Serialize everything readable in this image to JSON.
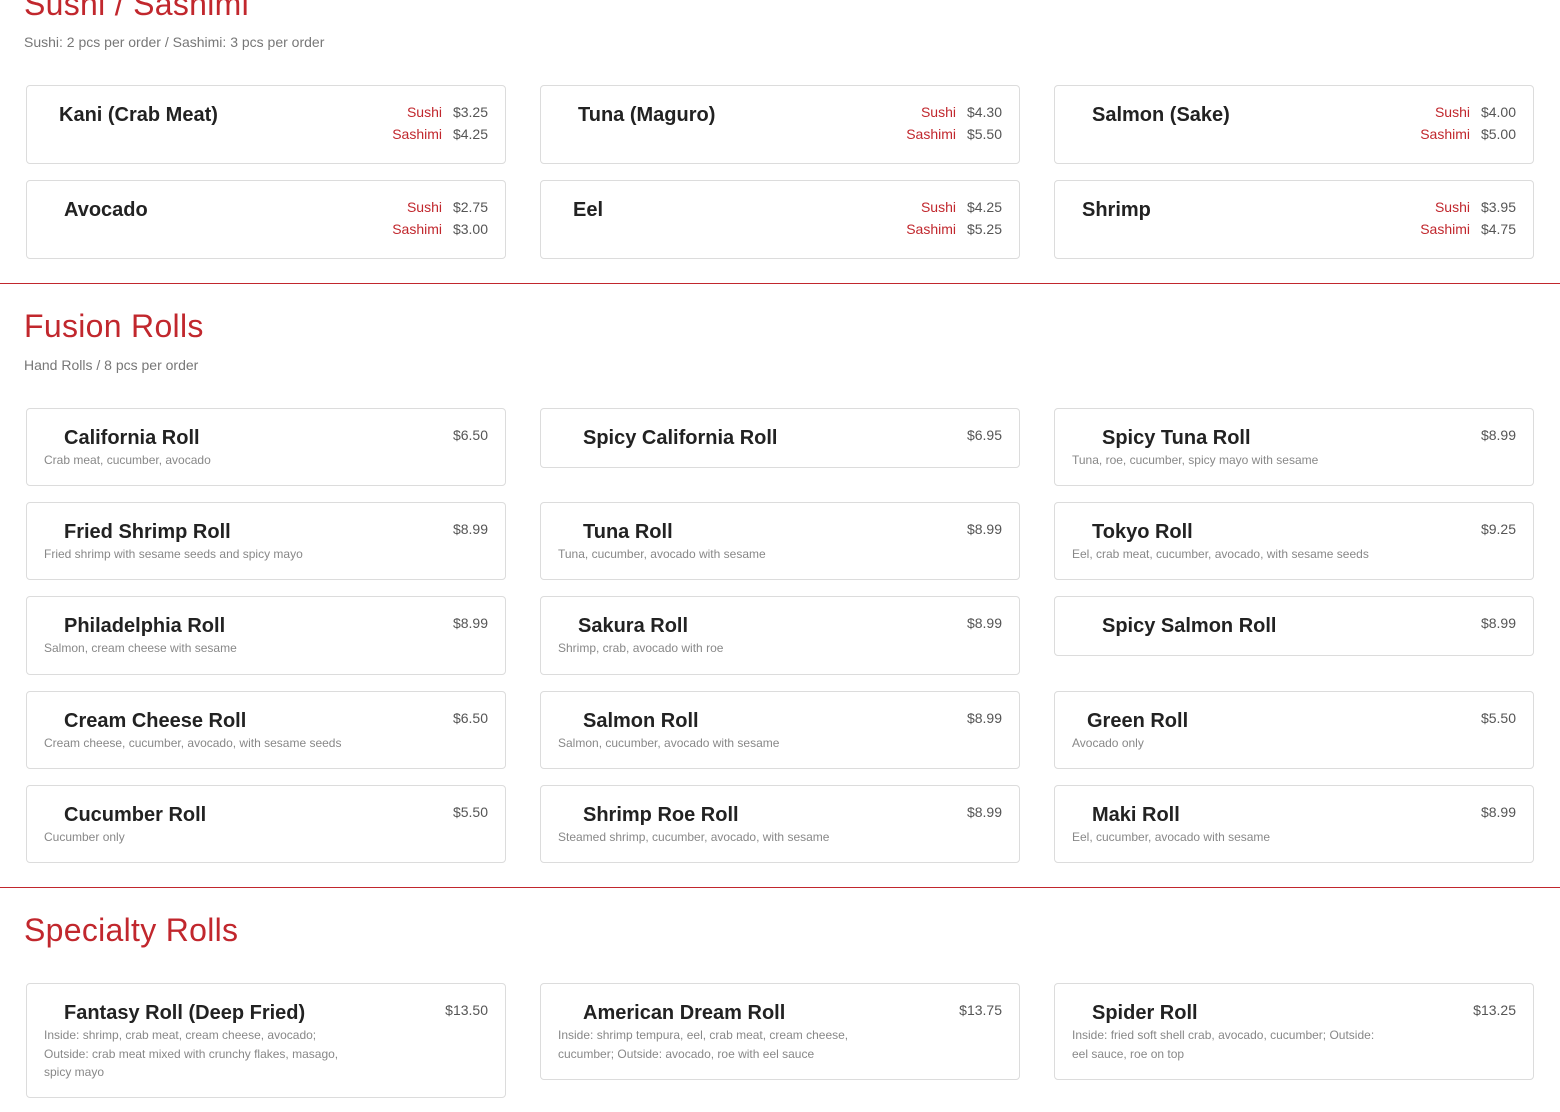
{
  "sections": {
    "sushi": {
      "title": "Sushi / Sashimi",
      "subtitle": "Sushi: 2 pcs per order / Sashimi: 3 pcs per order",
      "sushi_label": "Sushi",
      "sashimi_label": "Sashimi",
      "items": [
        {
          "name": "Kani (Crab Meat)",
          "sushi": "$3.25",
          "sashimi": "$4.25"
        },
        {
          "name": "Tuna (Maguro)",
          "sushi": "$4.30",
          "sashimi": "$5.50"
        },
        {
          "name": "Salmon (Sake)",
          "sushi": "$4.00",
          "sashimi": "$5.00"
        },
        {
          "name": "Avocado",
          "sushi": "$2.75",
          "sashimi": "$3.00"
        },
        {
          "name": "Eel",
          "sushi": "$4.25",
          "sashimi": "$5.25"
        },
        {
          "name": "Shrimp",
          "sushi": "$3.95",
          "sashimi": "$4.75"
        }
      ]
    },
    "fusion": {
      "title": "Fusion Rolls",
      "subtitle": "Hand Rolls / 8 pcs per order",
      "items": [
        {
          "name": "California Roll",
          "price": "$6.50",
          "desc": "Crab meat, cucumber, avocado"
        },
        {
          "name": "Spicy California Roll",
          "price": "$6.95",
          "desc": ""
        },
        {
          "name": "Spicy Tuna Roll",
          "price": "$8.99",
          "desc": "Tuna, roe, cucumber, spicy mayo with sesame"
        },
        {
          "name": "Fried Shrimp Roll",
          "price": "$8.99",
          "desc": "Fried shrimp with sesame seeds and spicy mayo"
        },
        {
          "name": "Tuna Roll",
          "price": "$8.99",
          "desc": "Tuna, cucumber, avocado with sesame"
        },
        {
          "name": "Tokyo Roll",
          "price": "$9.25",
          "desc": "Eel, crab meat, cucumber, avocado, with sesame seeds"
        },
        {
          "name": "Philadelphia Roll",
          "price": "$8.99",
          "desc": "Salmon, cream cheese with sesame"
        },
        {
          "name": "Sakura Roll",
          "price": "$8.99",
          "desc": "Shrimp, crab, avocado with roe"
        },
        {
          "name": "Spicy Salmon Roll",
          "price": "$8.99",
          "desc": ""
        },
        {
          "name": "Cream Cheese Roll",
          "price": "$6.50",
          "desc": "Cream cheese, cucumber, avocado, with sesame seeds"
        },
        {
          "name": "Salmon Roll",
          "price": "$8.99",
          "desc": "Salmon, cucumber, avocado with sesame"
        },
        {
          "name": "Green Roll",
          "price": "$5.50",
          "desc": "Avocado only"
        },
        {
          "name": "Cucumber Roll",
          "price": "$5.50",
          "desc": "Cucumber only"
        },
        {
          "name": "Shrimp Roe Roll",
          "price": "$8.99",
          "desc": "Steamed shrimp, cucumber, avocado, with sesame"
        },
        {
          "name": "Maki Roll",
          "price": "$8.99",
          "desc": "Eel, cucumber, avocado with sesame"
        }
      ]
    },
    "specialty": {
      "title": "Specialty Rolls",
      "items": [
        {
          "name": "Fantasy Roll (Deep Fried)",
          "price": "$13.50",
          "desc": "Inside: shrimp, crab meat, cream cheese, avocado; Outside: crab meat mixed with crunchy flakes, masago, spicy mayo"
        },
        {
          "name": "American Dream Roll",
          "price": "$13.75",
          "desc": "Inside: shrimp tempura, eel, crab meat, cream cheese, cucumber; Outside: avocado, roe with eel sauce"
        },
        {
          "name": "Spider Roll",
          "price": "$13.25",
          "desc": "Inside: fried soft shell crab, avocado, cucumber; Outside: eel sauce, roe on top"
        }
      ]
    }
  },
  "colors": {
    "accent": "#c1272d",
    "text": "#222222",
    "muted": "#888888",
    "border": "#dcdcdc"
  }
}
